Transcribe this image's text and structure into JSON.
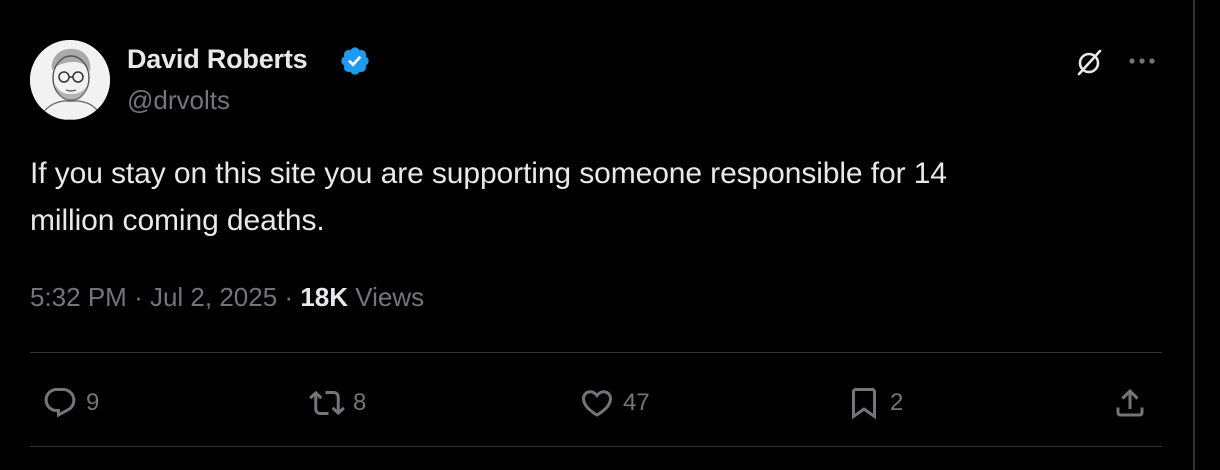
{
  "author": {
    "name": "David Roberts",
    "handle": "@drvolts",
    "verified": true
  },
  "tweet": {
    "text_line1": "If you stay on this site you are supporting someone responsible for 14",
    "text_line2": "million coming deaths."
  },
  "meta": {
    "time": "5:32 PM",
    "date": "Jul 2, 2025",
    "separator": "·",
    "views_count": "18K",
    "views_label": "Views"
  },
  "actions": {
    "replies": "9",
    "reposts": "8",
    "likes": "47",
    "bookmarks": "2"
  },
  "colors": {
    "background": "#000000",
    "text": "#e7e9ea",
    "muted": "#71767b",
    "verified": "#1d9bf0",
    "divider": "#2f3336"
  },
  "icons": [
    "verified-badge-icon",
    "grok-icon",
    "more-icon",
    "reply-icon",
    "repost-icon",
    "like-icon",
    "bookmark-icon",
    "share-icon"
  ]
}
